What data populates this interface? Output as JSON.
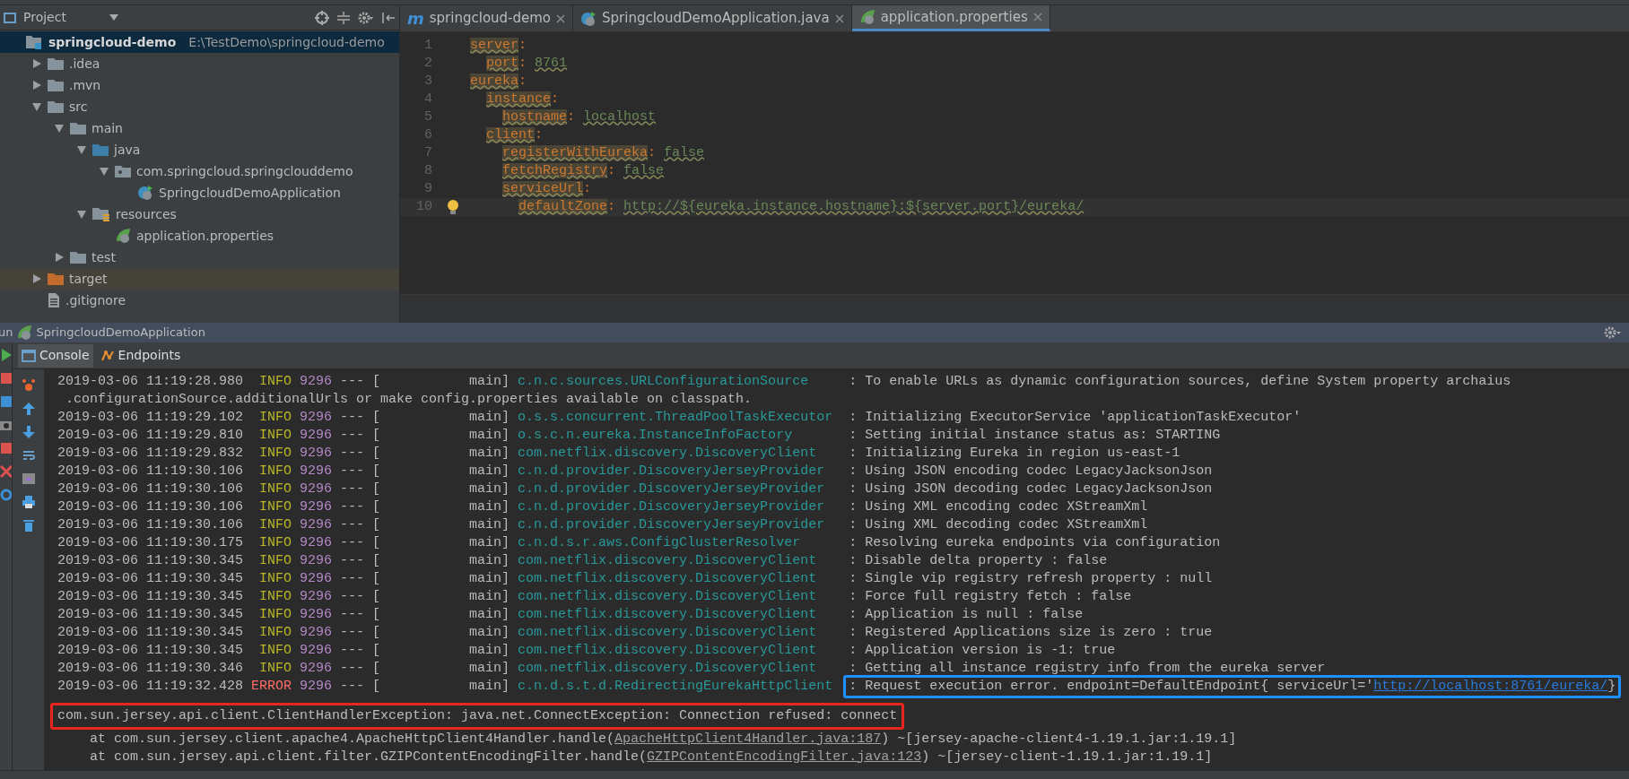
{
  "project_panel": {
    "title": "Project",
    "tree": [
      {
        "label": "springcloud-demo",
        "path": "E:\\TestDemo\\springcloud-demo",
        "kind": "module",
        "selected": true,
        "children": [
          {
            "label": ".idea",
            "kind": "folder",
            "expanded": false,
            "selected": false
          },
          {
            "label": ".mvn",
            "kind": "folder",
            "expanded": false,
            "selected": false
          },
          {
            "label": "src",
            "kind": "folder",
            "expanded": true,
            "selected": false,
            "children": [
              {
                "label": "main",
                "kind": "folder",
                "expanded": true,
                "selected": false,
                "children": [
                  {
                    "label": "java",
                    "kind": "source",
                    "expanded": true,
                    "selected": false,
                    "children": [
                      {
                        "label": "com.springcloud.springclouddemo",
                        "kind": "package",
                        "expanded": true,
                        "selected": false,
                        "children": [
                          {
                            "label": "SpringcloudDemoApplication",
                            "kind": "class",
                            "selected": false
                          }
                        ]
                      }
                    ]
                  },
                  {
                    "label": "resources",
                    "kind": "resources",
                    "expanded": true,
                    "selected": false,
                    "children": [
                      {
                        "label": "application.properties",
                        "kind": "spring",
                        "selected": false
                      }
                    ]
                  }
                ]
              },
              {
                "label": "test",
                "kind": "folder",
                "expanded": false,
                "selected": false
              }
            ]
          },
          {
            "label": "target",
            "kind": "excluded",
            "expanded": false,
            "selected": false
          },
          {
            "label": ".gitignore",
            "kind": "file",
            "selected": false
          }
        ]
      }
    ]
  },
  "editor": {
    "tabs": [
      {
        "label": "springcloud-demo",
        "kind": "maven",
        "icon": "m",
        "selected": false
      },
      {
        "label": "SpringcloudDemoApplication.java",
        "kind": "class",
        "selected": false
      },
      {
        "label": "application.properties",
        "kind": "spring",
        "selected": true
      }
    ],
    "code": [
      {
        "number": "1",
        "key": "server",
        "punct": ":",
        "children": [
          {
            "number": "2",
            "key": "port",
            "punct": ":",
            "value": "8761"
          }
        ]
      },
      {
        "number": "3",
        "key": "eureka",
        "punct": ":",
        "children": [
          {
            "number": "4",
            "key": "instance",
            "punct": ":",
            "children": [
              {
                "number": "5",
                "key": "hostname",
                "punct": ":",
                "value": "localhost"
              }
            ]
          },
          {
            "number": "6",
            "key": "client",
            "punct": ":",
            "children": [
              {
                "number": "7",
                "key": "registerWithEureka",
                "punct": ":",
                "value": "false"
              },
              {
                "number": "8",
                "key": "fetchRegistry",
                "punct": ":",
                "value": "false"
              },
              {
                "number": "9",
                "key": "serviceUrl",
                "punct": ":",
                "children": [
                  {
                    "number": "10",
                    "key": "defaultZone",
                    "punct": ":",
                    "value": "http://${eureka.instance.hostname}:${server.port}/eureka/",
                    "current": true
                  }
                ]
              }
            ]
          }
        ]
      }
    ]
  },
  "run_bar": {
    "label": "un",
    "config": "SpringcloudDemoApplication"
  },
  "console": {
    "tabs": [
      {
        "label": "Console",
        "selected": true
      },
      {
        "label": "Endpoints",
        "selected": false
      }
    ],
    "lines": [
      {
        "kind": "log",
        "timestamp": "2019-03-06 11:19:28.980",
        "level": "INFO",
        "color": "#bbb529",
        "pid": "9296",
        "sep": "--- [",
        "thread": "main]",
        "logger": "c.n.c.sources.URLConfigurationSource",
        "message": ": To enable URLs as dynamic configuration sources, define System property archaius"
      },
      {
        "kind": "continuation",
        "text": ".configurationSource.additionalUrls or make config.properties available on classpath."
      },
      {
        "kind": "log",
        "timestamp": "2019-03-06 11:19:29.102",
        "level": "INFO",
        "color": "#bbb529",
        "pid": "9296",
        "sep": "--- [",
        "thread": "main]",
        "logger": "o.s.s.concurrent.ThreadPoolTaskExecutor",
        "message": ": Initializing ExecutorService 'applicationTaskExecutor'"
      },
      {
        "kind": "log",
        "timestamp": "2019-03-06 11:19:29.810",
        "level": "INFO",
        "color": "#bbb529",
        "pid": "9296",
        "sep": "--- [",
        "thread": "main]",
        "logger": "o.s.c.n.eureka.InstanceInfoFactory",
        "message": ": Setting initial instance status as: STARTING"
      },
      {
        "kind": "log",
        "timestamp": "2019-03-06 11:19:29.832",
        "level": "INFO",
        "color": "#bbb529",
        "pid": "9296",
        "sep": "--- [",
        "thread": "main]",
        "logger": "com.netflix.discovery.DiscoveryClient",
        "message": ": Initializing Eureka in region us-east-1"
      },
      {
        "kind": "log",
        "timestamp": "2019-03-06 11:19:30.106",
        "level": "INFO",
        "color": "#bbb529",
        "pid": "9296",
        "sep": "--- [",
        "thread": "main]",
        "logger": "c.n.d.provider.DiscoveryJerseyProvider",
        "message": ": Using JSON encoding codec LegacyJacksonJson"
      },
      {
        "kind": "log",
        "timestamp": "2019-03-06 11:19:30.106",
        "level": "INFO",
        "color": "#bbb529",
        "pid": "9296",
        "sep": "--- [",
        "thread": "main]",
        "logger": "c.n.d.provider.DiscoveryJerseyProvider",
        "message": ": Using JSON decoding codec LegacyJacksonJson"
      },
      {
        "kind": "log",
        "timestamp": "2019-03-06 11:19:30.106",
        "level": "INFO",
        "color": "#bbb529",
        "pid": "9296",
        "sep": "--- [",
        "thread": "main]",
        "logger": "c.n.d.provider.DiscoveryJerseyProvider",
        "message": ": Using XML encoding codec XStreamXml"
      },
      {
        "kind": "log",
        "timestamp": "2019-03-06 11:19:30.106",
        "level": "INFO",
        "color": "#bbb529",
        "pid": "9296",
        "sep": "--- [",
        "thread": "main]",
        "logger": "c.n.d.provider.DiscoveryJerseyProvider",
        "message": ": Using XML decoding codec XStreamXml"
      },
      {
        "kind": "log",
        "timestamp": "2019-03-06 11:19:30.175",
        "level": "INFO",
        "color": "#bbb529",
        "pid": "9296",
        "sep": "--- [",
        "thread": "main]",
        "logger": "c.n.d.s.r.aws.ConfigClusterResolver",
        "message": ": Resolving eureka endpoints via configuration"
      },
      {
        "kind": "log",
        "timestamp": "2019-03-06 11:19:30.345",
        "level": "INFO",
        "color": "#bbb529",
        "pid": "9296",
        "sep": "--- [",
        "thread": "main]",
        "logger": "com.netflix.discovery.DiscoveryClient",
        "message": ": Disable delta property : false"
      },
      {
        "kind": "log",
        "timestamp": "2019-03-06 11:19:30.345",
        "level": "INFO",
        "color": "#bbb529",
        "pid": "9296",
        "sep": "--- [",
        "thread": "main]",
        "logger": "com.netflix.discovery.DiscoveryClient",
        "message": ": Single vip registry refresh property : null"
      },
      {
        "kind": "log",
        "timestamp": "2019-03-06 11:19:30.345",
        "level": "INFO",
        "color": "#bbb529",
        "pid": "9296",
        "sep": "--- [",
        "thread": "main]",
        "logger": "com.netflix.discovery.DiscoveryClient",
        "message": ": Force full registry fetch : false"
      },
      {
        "kind": "log",
        "timestamp": "2019-03-06 11:19:30.345",
        "level": "INFO",
        "color": "#bbb529",
        "pid": "9296",
        "sep": "--- [",
        "thread": "main]",
        "logger": "com.netflix.discovery.DiscoveryClient",
        "message": ": Application is null : false"
      },
      {
        "kind": "log",
        "timestamp": "2019-03-06 11:19:30.345",
        "level": "INFO",
        "color": "#bbb529",
        "pid": "9296",
        "sep": "--- [",
        "thread": "main]",
        "logger": "com.netflix.discovery.DiscoveryClient",
        "message": ": Registered Applications size is zero : true"
      },
      {
        "kind": "log",
        "timestamp": "2019-03-06 11:19:30.345",
        "level": "INFO",
        "color": "#bbb529",
        "pid": "9296",
        "sep": "--- [",
        "thread": "main]",
        "logger": "com.netflix.discovery.DiscoveryClient",
        "message": ": Application version is -1: true"
      },
      {
        "kind": "log",
        "timestamp": "2019-03-06 11:19:30.346",
        "level": "INFO",
        "color": "#bbb529",
        "pid": "9296",
        "sep": "--- [",
        "thread": "main]",
        "logger": "com.netflix.discovery.DiscoveryClient",
        "message": ": Getting all instance registry info from the eureka server"
      },
      {
        "kind": "log",
        "timestamp": "2019-03-06 11:19:32.428",
        "level": "ERROR",
        "color": "#ff6b68",
        "pid": "9296",
        "sep": "--- [",
        "thread": "main]",
        "logger": "c.n.d.s.t.d.RedirectingEurekaHttpClient",
        "message": ": Request execution error. endpoint=DefaultEndpoint{ serviceUrl='",
        "link": "http://localhost:8761/eureka/",
        "message_end": "}",
        "highlight": {
          "color": "#1e90ff"
        }
      },
      {
        "kind": "exception",
        "text": "com.sun.jersey.api.client.ClientHandlerException: java.net.ConnectException: Connection refused: connect",
        "highlight": {
          "color": "#e8261d"
        }
      },
      {
        "kind": "stack",
        "text": "at com.sun.jersey.client.apache4.ApacheHttpClient4Handler.handle(",
        "link": "ApacheHttpClient4Handler.java:187",
        "message_end": ") ~[jersey-apache-client4-1.19.1.jar:1.19.1]"
      },
      {
        "kind": "stack",
        "text": "at com.sun.jersey.api.client.filter.GZIPContentEncodingFilter.handle(",
        "link": "GZIPContentEncodingFilter.java:123",
        "message_end": ") ~[jersey-client-1.19.1.jar:1.19.1]"
      }
    ]
  }
}
